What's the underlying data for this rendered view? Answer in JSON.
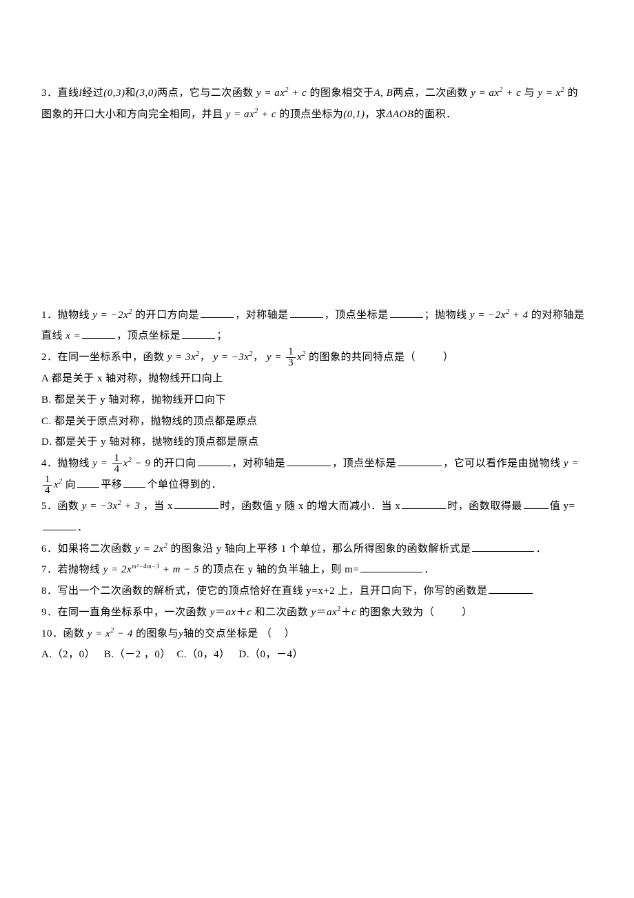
{
  "top": {
    "q3": {
      "num": "3．",
      "t1": "直线",
      "t2": "经过",
      "t3": "和",
      "t4": "两点，它与二次函数",
      "t5": "的图象相交于",
      "t6": "两点，二次函数",
      "t7": "与",
      "t8": "的图象的开口大小和方向完全相同，并且",
      "t9": "的顶点坐标为",
      "t10": "，求",
      "t11": "的面积．",
      "lvar": "l",
      "p1": "(0,3)",
      "p2": "(3,0)",
      "eq1a": "y = ax",
      "eq1b": " + c",
      "ab": "A, B",
      "eq2a": "y = ax",
      "eq2b": " + c",
      "eq3a": "y = x",
      "eq4a": "y = ax",
      "eq4b": " + c",
      "vpt": "(0,1)",
      "tri": "ΔAOB"
    }
  },
  "bottom": {
    "q1": {
      "num": "1．",
      "t1": "抛物线",
      "eq1a": "y = −2x",
      "t2": "的开口方向是",
      "t3": "，对称轴是",
      "t4": "，顶点坐标是",
      "t5": "；抛物线",
      "eq2a": "y = −2x",
      "eq2b": " + 4",
      "t6": "的对称轴是直线",
      "t7": "x =",
      "t8": "，顶点坐标是",
      "t9": "；"
    },
    "q2": {
      "num": "2．",
      "t1": "在同一坐标系中，函数",
      "eq1": "y = 3x",
      "t2": "，",
      "eq2": "y = −3x",
      "t3": "，",
      "eq3pre": "y = ",
      "frac_num": "1",
      "frac_den": "3",
      "eq3post": "x",
      "t4": "的图象的共同特点是（",
      "close": "）",
      "a": "A 都是关于 x 轴对称，抛物线开口向上",
      "b": "B. 都是关于 y 轴对称，抛物线开口向下",
      "c": "C. 都是关于原点对称，抛物线的顶点都是原点",
      "d": "D. 都是关于 y 轴对称，抛物线的顶点都是原点"
    },
    "q4": {
      "num": "4．",
      "t1": "抛物线",
      "eq1pre": "y = ",
      "frac_num": "1",
      "frac_den": "4",
      "eq1post": "x",
      "eq1tail": " − 9",
      "t2": "的开口向",
      "t3": "，对称轴是",
      "t4": "，顶点坐标是",
      "t5": "，它可以看作是由抛物线",
      "eq2pre": "y = ",
      "t6": "向",
      "t7": "平移",
      "t8": "个单位得到的．"
    },
    "q5": {
      "num": "5．",
      "t1": "函数",
      "eq1a": "y = −3x",
      "eq1b": " + 3",
      "t2": "，当 x",
      "t3": "时，函数值 y 随 x 的增大而减小．当 x",
      "t4": "时，函数取得最",
      "t5": "值 y=",
      "t6": "．"
    },
    "q6": {
      "num": "6．",
      "t1": "如果将二次函数",
      "eq1a": "y = 2x",
      "t2": "的图象沿 y 轴向上平移 1 个单位，那么所得图象的函数解析式是",
      "t3": "．"
    },
    "q7": {
      "num": "7．",
      "t1": "若抛物线",
      "eq1a": "y = 2x",
      "exp": "m²−4m−3",
      "eq1b": " + m − 5",
      "t2": "的顶点在 y 轴的负半轴上，则 m=",
      "t3": "．"
    },
    "q8": {
      "num": "8．",
      "t": "写出一个二次函数的解析式，使它的顶点恰好在直线 y=x+2 上，且开口向下，你写的函数是"
    },
    "q9": {
      "num": "9．",
      "t1": "在同一直角坐标系中，一次函数 ",
      "e1a": "y",
      "e1b": "＝",
      "e1c": "ax",
      "e1d": "＋",
      "e1e": "c",
      "t2": " 和二次函数 ",
      "e2a": "y",
      "e2b": "＝",
      "e2c": "ax",
      "e2d": "＋",
      "e2e": "c",
      "t3": " 的图象大致为（",
      "close": "）"
    },
    "q10": {
      "num": "10．",
      "t1": "函数",
      "eq1a": "y = x",
      "eq1b": " − 4",
      "t2": "的图象与",
      "yvar": "y",
      "t3": "轴的交点坐标是   （",
      "close": "）",
      "a": "A.（2，0）",
      "b": "B.（－2 ，0）",
      "c": "C.（0，4）",
      "d": "D.（0，－4）"
    }
  }
}
